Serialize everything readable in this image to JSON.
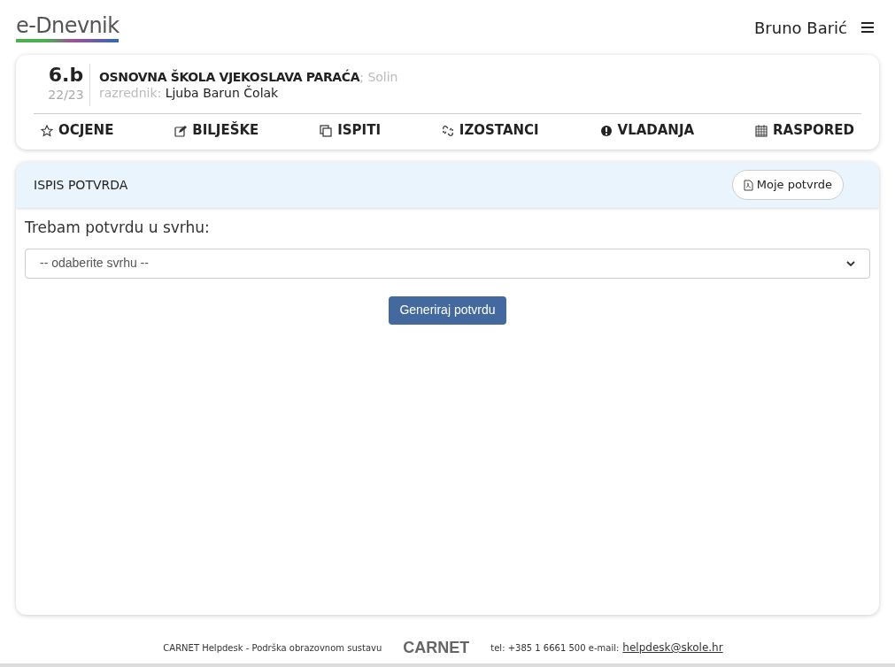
{
  "header": {
    "logo": "e-Dnevnik",
    "user": "Bruno Barić"
  },
  "class_card": {
    "class": "6.b",
    "year": "22/23",
    "school": "OSNOVNA ŠKOLA VJEKOSLAVA PARAĆA",
    "city": "; Solin",
    "teacher_label": "razrednik:",
    "teacher": "Ljuba Barun Čolak",
    "nav": [
      {
        "label": "OCJENE"
      },
      {
        "label": "BILJEŠKE"
      },
      {
        "label": "ISPITI"
      },
      {
        "label": "IZOSTANCI"
      },
      {
        "label": "VLADANJA"
      },
      {
        "label": "RASPORED"
      }
    ]
  },
  "panel": {
    "title": "ISPIS POTVRDA",
    "my_button": "Moje potvrde",
    "field_label": "Trebam potvrdu u svrhu:",
    "select_value": "-- odaberite svrhu --",
    "generate_button": "Generiraj potvrdu"
  },
  "footer": {
    "helpdesk": "CARNET Helpdesk - Podrška obrazovnom sustavu",
    "logo": "CARNET",
    "contact": "tel: +385 1 6661 500 e-mail:",
    "email": "helpdesk@skole.hr"
  }
}
